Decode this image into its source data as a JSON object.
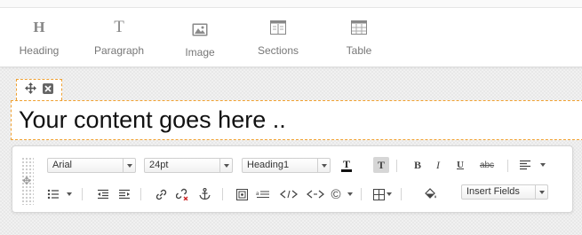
{
  "toolbar": {
    "items": [
      {
        "label": "Heading",
        "icon": "heading-icon"
      },
      {
        "label": "Paragraph",
        "icon": "paragraph-icon"
      },
      {
        "label": "Image",
        "icon": "image-icon"
      },
      {
        "label": "Sections",
        "icon": "sections-icon"
      },
      {
        "label": "Table",
        "icon": "table-icon"
      }
    ]
  },
  "block": {
    "content_text": "Your content goes here .."
  },
  "editor": {
    "font_family": "Arial",
    "font_size": "24pt",
    "format": "Heading1",
    "insert_fields": "Insert Fields",
    "bold_label": "B",
    "italic_label": "I",
    "underline_label": "U",
    "strike_label": "abc"
  },
  "colors": {
    "accent_dashed": "#f0a030",
    "strike_red": "#cc2222"
  }
}
